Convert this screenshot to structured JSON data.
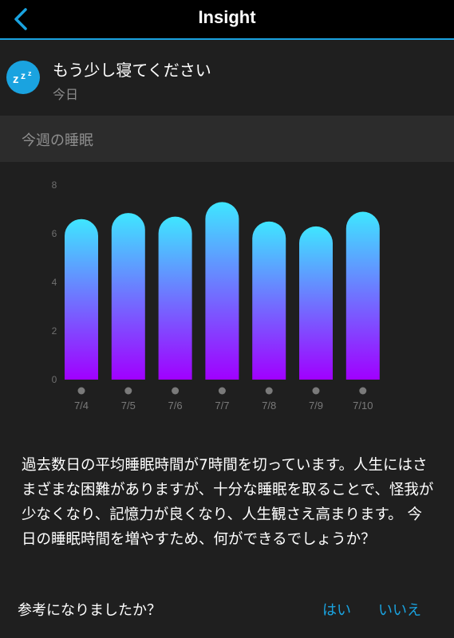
{
  "header": {
    "title": "Insight",
    "back_icon": "chevron-left-icon"
  },
  "insight": {
    "icon": "zzz-sleep-icon",
    "icon_text": "z",
    "title": "もう少し寝てください",
    "date": "今日"
  },
  "section": {
    "title": "今週の睡眠"
  },
  "chart_data": {
    "type": "bar",
    "categories": [
      "7/4",
      "7/5",
      "7/6",
      "7/7",
      "7/8",
      "7/9",
      "7/10"
    ],
    "values": [
      6.6,
      6.85,
      6.7,
      7.3,
      6.5,
      6.3,
      6.9
    ],
    "yticks": [
      0,
      2,
      4,
      6,
      8
    ],
    "ylim": [
      0,
      8
    ],
    "grid": false,
    "gradient_top": "#3fe6ff",
    "gradient_bottom": "#a000ff"
  },
  "body": {
    "text": "過去数日の平均睡眠時間が7時間を切っています。人生にはさまざまな困難がありますが、十分な睡眠を取ることで、怪我が少なくなり、記憶力が良くなり、人生観さえ高まります。 今日の睡眠時間を増やすため、何ができるでしょうか？"
  },
  "feedback": {
    "question": "参考になりましたか？",
    "yes_label": "はい",
    "no_label": "いいえ"
  },
  "colors": {
    "accent": "#1aa3e0",
    "background": "#1f1f1f",
    "topbar": "#000000"
  }
}
